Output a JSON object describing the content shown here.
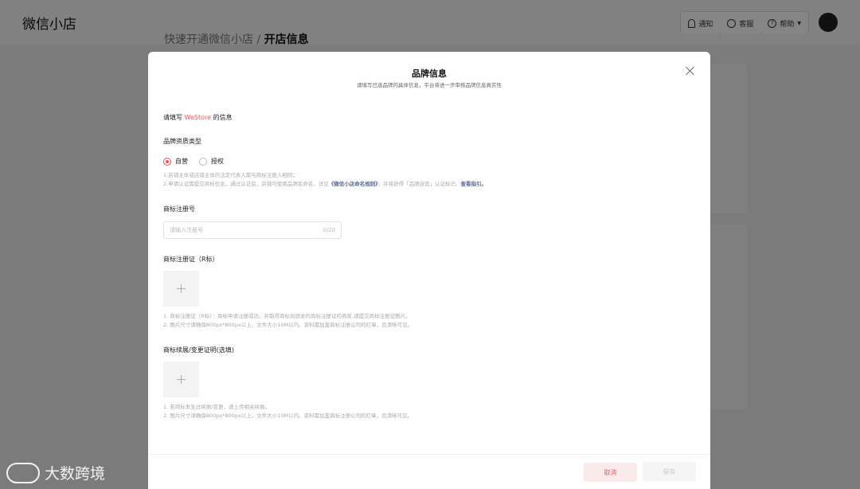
{
  "app": {
    "logo": "微信小店",
    "header": {
      "notify_label": "通知",
      "service_label": "客服",
      "help_label": "帮助"
    },
    "breadcrumb": {
      "parent": "快速开通微信小店",
      "separator": "/",
      "current": "开店信息"
    }
  },
  "modal": {
    "title": "品牌信息",
    "subtitle": "请填写已选品牌的具体信息，平台将进一步审核品牌信息真实性",
    "fill_prefix": "请填写",
    "brand_name": "WeStore",
    "fill_suffix": "的信息",
    "qualification": {
      "label": "品牌资质类型",
      "options": [
        "自营",
        "授权"
      ],
      "selected": "自营",
      "hint_1": "1.店铺主体或店铺主体的法定代表人需与商标注册人相同；",
      "hint_2_prefix": "2.申请认证需提交商标信息，通过认证后，店铺可使用品牌名命名，详见",
      "hint_2_link": "《微信小店命名规则》",
      "hint_2_suffix": "；并将获得「品牌自营」认证标识。",
      "hint_2_guide": "查看指引。"
    },
    "reg_number": {
      "label": "商标注册号",
      "placeholder": "请输入注册号",
      "value": "",
      "counter": "0/20"
    },
    "certificate": {
      "label": "商标注册证（R标）",
      "hint_1": "1. 商标注册证（R标）：商标申请注册成功，并取得商标局颁发的商标注册证的商家,请提交商标注册证图片。",
      "hint_2": "2. 图片尺寸请确保800px*800px以上，文件大小10M以内。资料需加盖商标注册公司的红章，且清晰可见。"
    },
    "renewal": {
      "label": "商标续展/变更证明(选填)",
      "hint_1": "1. 若商标发生过续展/变更，请上传相关续展。",
      "hint_2": "2. 图片尺寸请确保800px*800px以上，文件大小10M以内。资料需加盖商标注册公司的红章，且清晰可见。"
    },
    "footer": {
      "cancel_label": "取消",
      "save_label": "保存"
    }
  },
  "watermark": "大数跨境",
  "colors": {
    "accent": "#fa5151",
    "link": "#576b95"
  }
}
